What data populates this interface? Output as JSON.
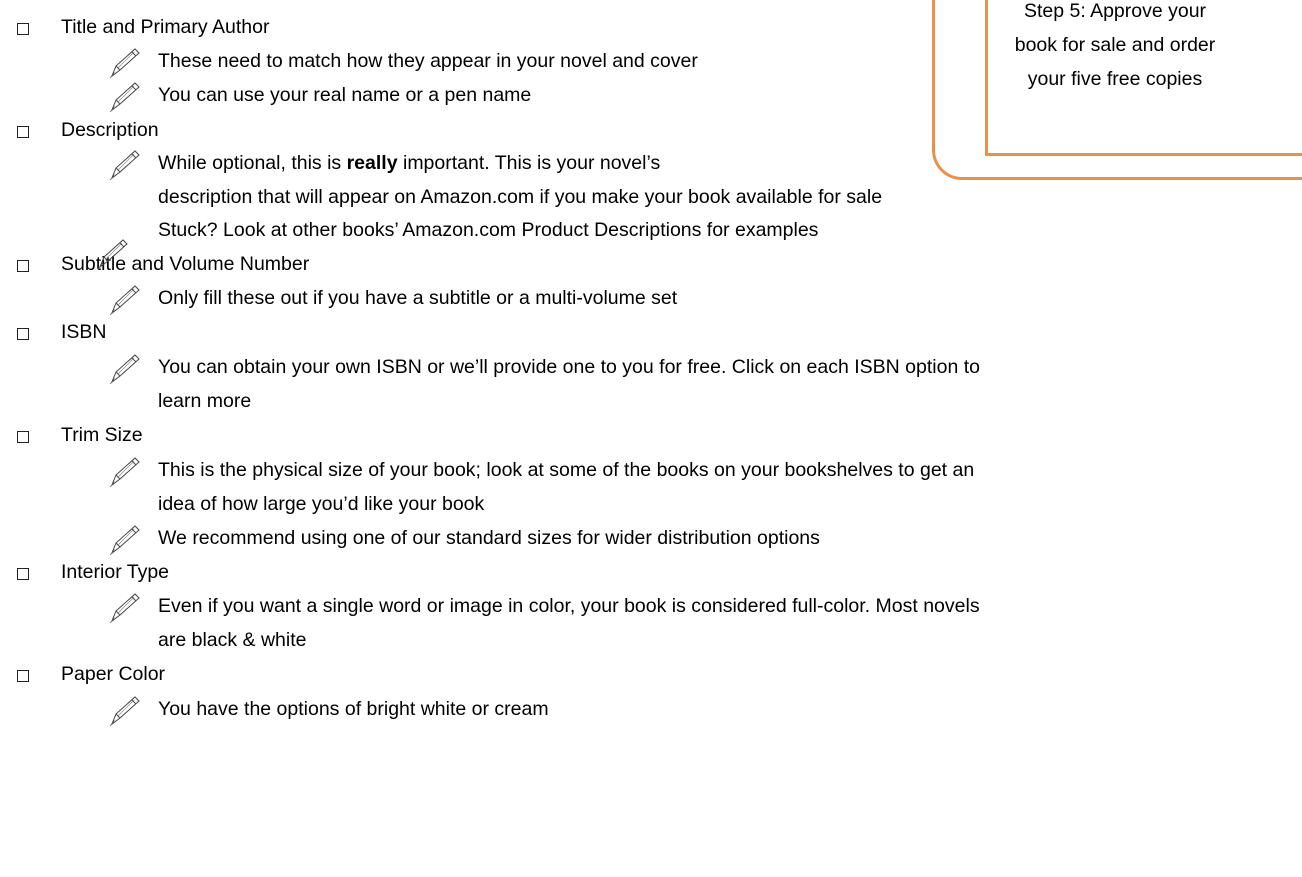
{
  "callout": {
    "lines": [
      "Step 5: Approve your",
      "book for sale and order",
      "your five free copies"
    ],
    "border_color": "#e8914a"
  },
  "items": [
    {
      "label": "Title and Primary Author",
      "notes": [
        {
          "lines": [
            "These need to match how they appear in your novel and cover"
          ]
        },
        {
          "lines": [
            "You can use your real name or a pen name"
          ]
        }
      ]
    },
    {
      "label": "Description",
      "notes": [
        {
          "pre": "While optional, this is ",
          "bold": "really",
          "post": " important. This is your novel’s",
          "lines": [
            "description that will appear on Amazon.com if you make your book available for sale",
            "Stuck? Look at other books’ Amazon.com Product Descriptions for examples"
          ]
        }
      ]
    },
    {
      "label": "Subtitle and Volume Number",
      "notes": [
        {
          "lines": [
            "Only fill these out if you have a subtitle or a multi-volume set"
          ]
        }
      ]
    },
    {
      "label": "ISBN",
      "notes": [
        {
          "lines": [
            "You can obtain your own ISBN or we’ll provide one to you for free. Click on each ISBN option to",
            "learn more"
          ]
        }
      ]
    },
    {
      "label": "Trim Size",
      "notes": [
        {
          "lines": [
            "This is the physical size of your book; look at some of the books on your bookshelves to get an",
            "idea of how large you’d like your book"
          ]
        },
        {
          "lines": [
            "We recommend using one of our standard sizes for wider distribution options"
          ]
        }
      ]
    },
    {
      "label": "Interior Type",
      "notes": [
        {
          "lines": [
            "Even if you want a single word or image in color, your book is considered full-color. Most novels",
            "are black & white"
          ]
        }
      ]
    },
    {
      "label": "Paper Color",
      "notes": [
        {
          "lines": [
            "You have the options of bright white or cream"
          ]
        }
      ]
    }
  ],
  "icons": {
    "checkbox": "checkbox-icon",
    "note": "pencil-icon"
  }
}
